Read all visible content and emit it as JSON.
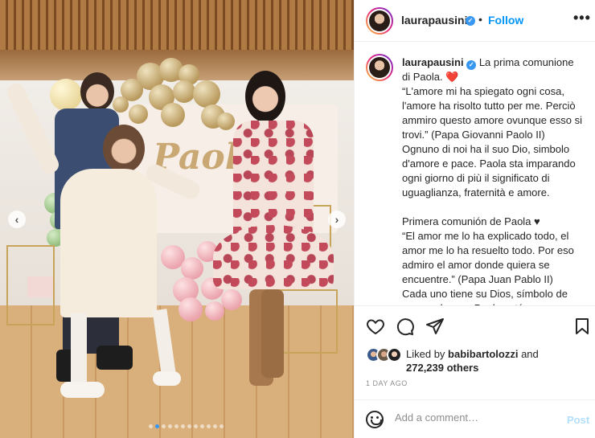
{
  "post": {
    "username": "laurapausini",
    "follow_label": "Follow",
    "separator": "•",
    "more_label": "•••",
    "verified_mark": "✓"
  },
  "photo": {
    "banner_text": "Paola",
    "prev_arrow": "‹",
    "next_arrow": "›",
    "carousel_count": 12,
    "active_index": 1
  },
  "caption": {
    "username": "laurapausini",
    "line_1": "La prima comunione di Paola.",
    "heart_red": "❤️",
    "para_1": "“L'amore mi ha spiegato ogni cosa, l'amore ha risolto tutto per me. Perciò ammiro questo amore ovunque esso si trovi.” (Papa Giovanni Paolo II)",
    "para_2": "Ognuno di noi ha il suo Dio, simbolo d'amore e pace. Paola sta imparando ogni giorno di più il significato di uguaglianza, fraternità e amore.",
    "para_3_title": "Primera comunión de Paola",
    "heart_black": "♥",
    "para_4": "“El amor me lo ha explicado todo, el amor me lo ha resuelto todo. Por eso admiro el amor donde quiera se encuentre.” (Papa Juan Pablo II)",
    "para_5": "Cada uno tiene su Dios, símbolo de amor y de paz. Paola está"
  },
  "likes": {
    "prefix": "Liked by",
    "by_user": "babibartolozzi",
    "and": "and",
    "count": "272,239 others"
  },
  "time_ago": "1 DAY AGO",
  "comment": {
    "placeholder": "Add a comment…",
    "post_label": "Post"
  },
  "icons": {
    "like": "heart-icon",
    "comment": "comment-icon",
    "share": "share-icon",
    "save": "bookmark-icon",
    "emoji": "smiley-icon"
  },
  "colors": {
    "accent": "#0095f6",
    "post_disabled": "#b2dffc",
    "verified": "#3897f0",
    "like_heart": "#ed4956"
  }
}
